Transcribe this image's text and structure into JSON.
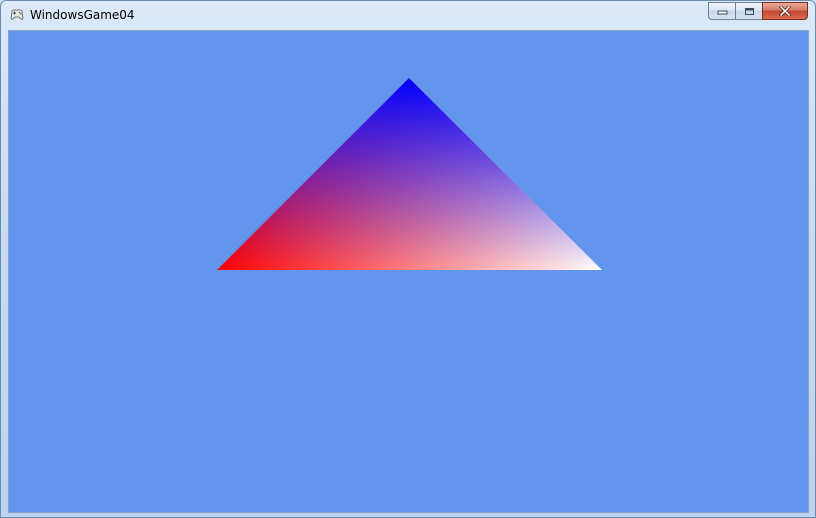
{
  "window": {
    "title": "WindowsGame04",
    "icon": "gamepad-icon",
    "caption_buttons": {
      "minimize": "minimize-icon",
      "maximize": "maximize-icon",
      "close": "close-icon"
    }
  },
  "scene": {
    "clear_color": "#6495ed",
    "triangle": {
      "vertex_colors": {
        "top": "#0000ff",
        "bottom_left": "#ff0000",
        "bottom_right": "#ffffff"
      }
    }
  }
}
